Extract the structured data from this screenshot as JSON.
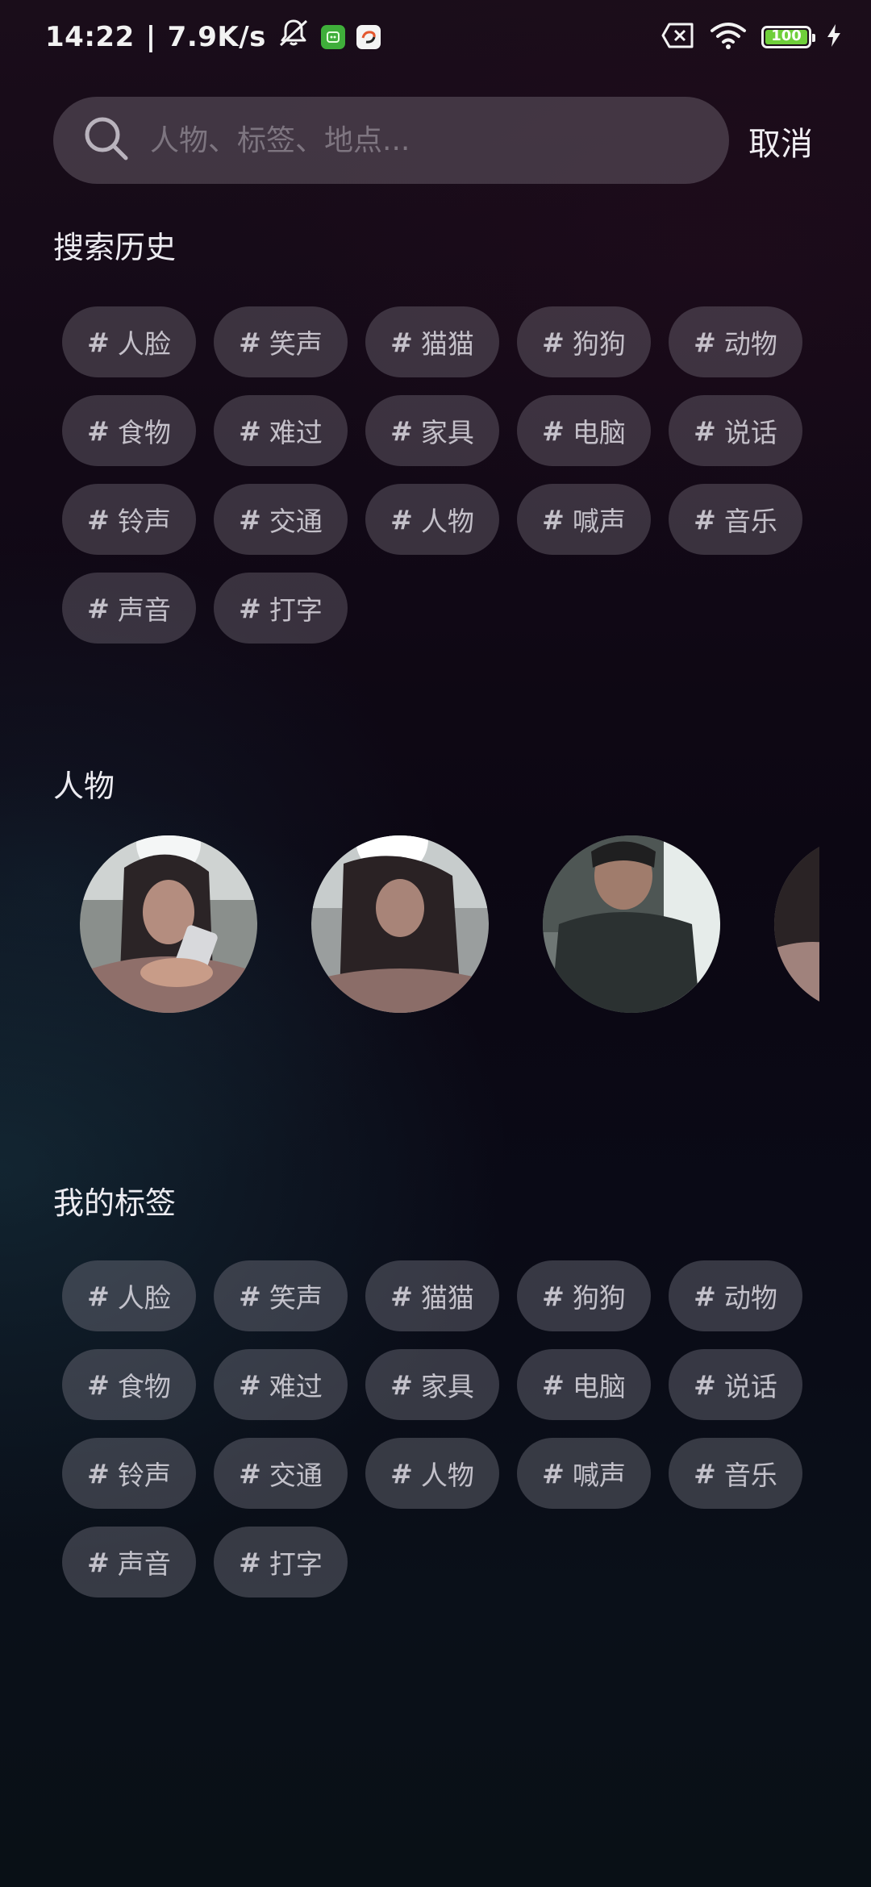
{
  "status_bar": {
    "time": "14:22",
    "separator": "|",
    "network_speed": "7.9K/s",
    "battery_level": "100",
    "icons": [
      "mute-icon",
      "app-icon-green",
      "app-icon-swirl",
      "sim-error-icon",
      "wifi-icon",
      "battery-icon",
      "charging-icon"
    ]
  },
  "search": {
    "placeholder": "人物、标签、地点...",
    "value": "",
    "cancel_label": "取消"
  },
  "history": {
    "title": "搜索历史",
    "chips": [
      "人脸",
      "笑声",
      "猫猫",
      "狗狗",
      "动物",
      "食物",
      "难过",
      "家具",
      "电脑",
      "说话",
      "铃声",
      "交通",
      "人物",
      "喊声",
      "音乐",
      "声音",
      "打字"
    ]
  },
  "people": {
    "title": "人物",
    "count_visible": 4
  },
  "tags": {
    "title": "我的标签",
    "chips": [
      "人脸",
      "笑声",
      "猫猫",
      "狗狗",
      "动物",
      "食物",
      "难过",
      "家具",
      "电脑",
      "说话",
      "铃声",
      "交通",
      "人物",
      "喊声",
      "音乐",
      "声音",
      "打字"
    ]
  },
  "hash_symbol": "#",
  "colors": {
    "background_top": "#1a0d1a",
    "background_bottom": "#091016",
    "chip_background": "#5e5862",
    "battery_green": "#6fcf3a",
    "text_primary": "#ecebf0"
  }
}
